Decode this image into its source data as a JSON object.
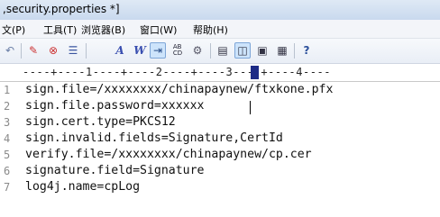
{
  "window": {
    "title": ",security.properties *]"
  },
  "menu": {
    "items": [
      {
        "label": "文(P)"
      },
      {
        "label": "工具(T)"
      },
      {
        "label": "浏览器(B)"
      },
      {
        "label": "窗口(W)"
      },
      {
        "label": "帮助(H)"
      }
    ]
  },
  "toolbar": {
    "buttons": [
      "undo-icon",
      "tag-icon",
      "remove-icon",
      "clipboard-icon",
      "font-icon",
      "word-wrap-icon",
      "indent-icon",
      "spell-check-icon",
      "settings-icon",
      "view-page-icon",
      "view-split-icon",
      "view-hex-icon",
      "view-text-icon",
      "help-icon"
    ],
    "active": [
      "indent-icon",
      "view-split-icon"
    ]
  },
  "ruler": {
    "text": "----+----1----+----2----+----3----+----4----"
  },
  "editor": {
    "lines": [
      {
        "num": "1",
        "text": "sign.file=/xxxxxxxx/chinapaynew/ftxkone.pfx"
      },
      {
        "num": "2",
        "text": "sign.file.password=xxxxxx"
      },
      {
        "num": "3",
        "text": "sign.cert.type=PKCS12"
      },
      {
        "num": "4",
        "text": "sign.invalid.fields=Signature,CertId"
      },
      {
        "num": "5",
        "text": "verify.file=/xxxxxxxx/chinapaynew/cp.cer"
      },
      {
        "num": "6",
        "text": "signature.field=Signature"
      },
      {
        "num": "7",
        "text": "log4j.name=cpLog"
      }
    ]
  }
}
